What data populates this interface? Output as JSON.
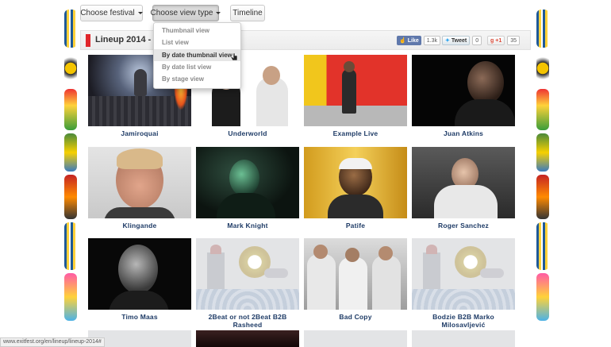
{
  "toolbar": {
    "festival_label": "Choose festival",
    "view_type_label": "Choose view type",
    "timeline_label": "Timeline"
  },
  "view_menu": {
    "items": [
      {
        "label": "Thumbnail view"
      },
      {
        "label": "List view"
      },
      {
        "label": "By date thumbnail view"
      },
      {
        "label": "By date list view"
      },
      {
        "label": "By stage view"
      }
    ]
  },
  "header": {
    "title": "Lineup 2014 - A",
    "facebook_label": "Like",
    "facebook_count": "1.3k",
    "twitter_label": "Tweet",
    "twitter_count": "0",
    "gplus_label": "+1",
    "gplus_count": "35"
  },
  "lineup": {
    "artists": [
      {
        "name": "Jamiroquai"
      },
      {
        "name": "Underworld"
      },
      {
        "name": "Example Live"
      },
      {
        "name": "Juan Atkins"
      },
      {
        "name": "Klingande"
      },
      {
        "name": "Mark Knight"
      },
      {
        "name": "Patife"
      },
      {
        "name": "Roger Sanchez"
      },
      {
        "name": "Timo Maas"
      },
      {
        "name": "2Beat or not 2Beat B2B Rasheed"
      },
      {
        "name": "Bad Copy"
      },
      {
        "name": "Bodzie B2B Marko Milosavljević"
      }
    ]
  },
  "status": {
    "url": "www.exitfest.org/en/lineup/lineup-2014#"
  },
  "colors": {
    "accent_red": "#e0262b",
    "artist_name": "#1e3b66",
    "facebook": "#5f78ab",
    "gplus": "#dd4b39"
  }
}
